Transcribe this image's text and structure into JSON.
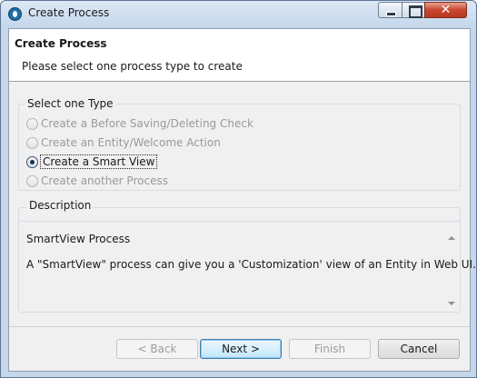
{
  "window": {
    "title": "Create Process",
    "controls": {
      "close_glyph": "✕"
    }
  },
  "header": {
    "title": "Create Process",
    "description": "Please select one process type to create"
  },
  "type_group": {
    "label": "Select one Type",
    "options": [
      {
        "label": "Create a Before Saving/Deleting Check",
        "selected": false,
        "enabled": false
      },
      {
        "label": "Create an Entity/Welcome Action",
        "selected": false,
        "enabled": false
      },
      {
        "label": "Create a Smart View",
        "selected": true,
        "enabled": true
      },
      {
        "label": "Create another Process",
        "selected": false,
        "enabled": false
      }
    ]
  },
  "description_group": {
    "label": "Description",
    "line1": "SmartView Process",
    "line2": "A \"SmartView\" process can give you a 'Customization' view of an Entity in Web UI."
  },
  "buttons": {
    "back": "< Back",
    "next": "Next >",
    "finish": "Finish",
    "cancel": "Cancel"
  }
}
